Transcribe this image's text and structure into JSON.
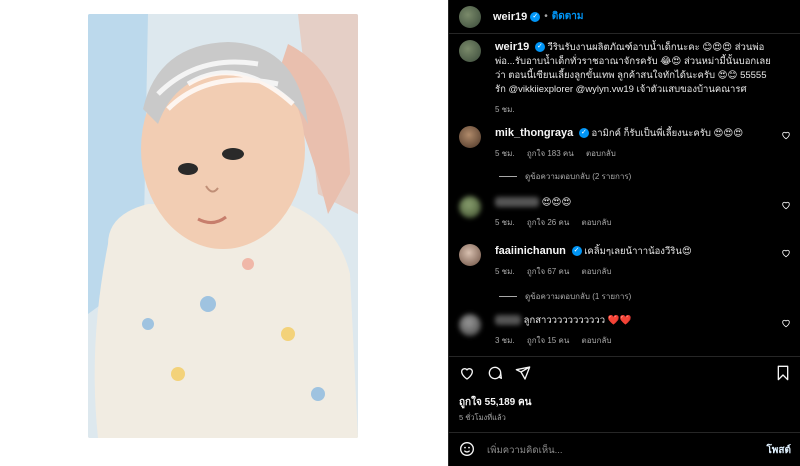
{
  "post": {
    "username": "weir19",
    "follow_label": "ติดตาม",
    "caption_user": "weir19",
    "caption_text": "วีรินรับงานผลิตภัณฑ์อาบน้ำเด็กนะคะ 😊😍😍 ส่วนพ่อ พ่อ...รับอาบน้ำเด็กทั่วราชอาณาจักรครับ 😂😍 ส่วนหม่ามี้นั้นบอกเลยว่า ตอนนี้เซียนเลี้ยงลูกขั้นเทพ ลูกค้าสนใจทักได้นะครับ 😍😊 55555 รัก @vikkiiexplorer @wylyn.vw19 เจ้าตัวแสบของบ้านคณารศ",
    "caption_time": "5 ชม.",
    "likes_label": "ถูกใจ 55,189 คน",
    "posted_time": "5 ชั่วโมงที่แล้ว",
    "add_comment_placeholder": "เพิ่มความคิดเห็น...",
    "post_button": "โพสต์"
  },
  "comments": [
    {
      "user": "mik_thongraya",
      "verified": true,
      "text": "อามิกค์ ก็รับเป็นพี่เลี้ยงนะครับ 😍😍😍",
      "time": "5 ชม.",
      "likes": "ถูกใจ 183 คน",
      "reply": "ตอบกลับ",
      "view_replies": "ดูข้อความตอบกลับ (2 รายการ)",
      "blurred": false
    },
    {
      "user": "",
      "verified": false,
      "text": "😍😍😍",
      "time": "5 ชม.",
      "likes": "ถูกใจ 26 คน",
      "reply": "ตอบกลับ",
      "view_replies": "",
      "blurred": true
    },
    {
      "user": "faaiinichanun",
      "verified": true,
      "text": "เคลิ้มๆเลยน้าาาน้องวีริน😍",
      "time": "5 ชม.",
      "likes": "ถูกใจ 67 คน",
      "reply": "ตอบกลับ",
      "view_replies": "ดูข้อความตอบกลับ (1 รายการ)",
      "blurred": false
    },
    {
      "user": "",
      "verified": false,
      "text": "ลูกสาววววววววววว ❤️❤️",
      "time": "3 ชม.",
      "likes": "ถูกใจ 15 คน",
      "reply": "ตอบกลับ",
      "view_replies": "",
      "blurred": true
    }
  ],
  "icons": {
    "heart": "heart-icon",
    "comment": "comment-icon",
    "share": "share-icon",
    "save": "bookmark-icon",
    "emoji": "emoji-icon"
  },
  "colors": {
    "accent": "#0095f6",
    "background": "#000000"
  }
}
